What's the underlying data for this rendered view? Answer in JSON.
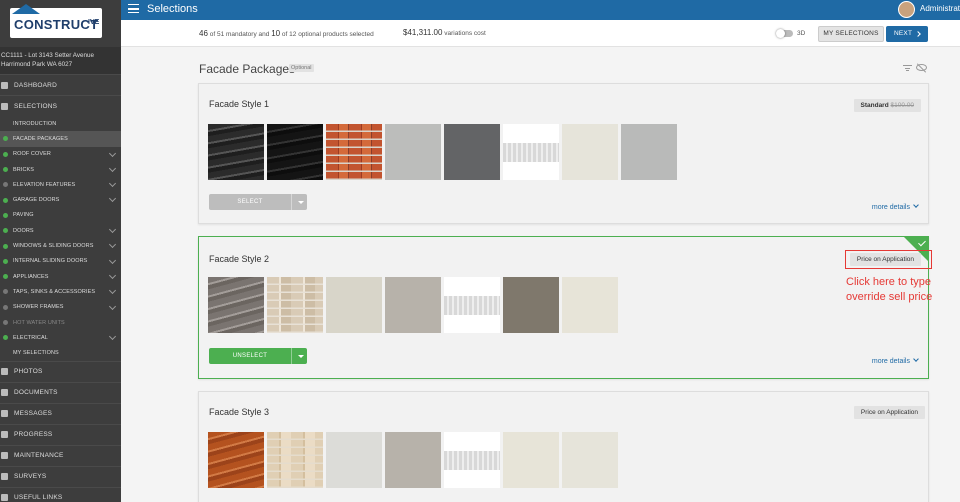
{
  "app": {
    "logo_text": "CONSTRUCT",
    "logo_suffix": "IVE",
    "page_title": "Selections",
    "user_name": "Administrator"
  },
  "sidebar": {
    "address_line1": "CC1111 - Lot 3143 Setter Avenue",
    "address_line2": "Harrimond Park WA 6027",
    "items": [
      {
        "label": "DASHBOARD",
        "type": "main",
        "icon": "dashboard-icon"
      },
      {
        "label": "SELECTIONS",
        "type": "main",
        "icon": "selections-icon"
      },
      {
        "label": "INTRODUCTION",
        "type": "plain"
      },
      {
        "label": "FACADE PACKAGES",
        "type": "sub",
        "status": "green",
        "active": true
      },
      {
        "label": "ROOF COVER",
        "type": "sub",
        "status": "green",
        "expand": true
      },
      {
        "label": "BRICKS",
        "type": "sub",
        "status": "green",
        "expand": true
      },
      {
        "label": "ELEVATION FEATURES",
        "type": "sub",
        "status": "grey",
        "expand": true
      },
      {
        "label": "GARAGE DOORS",
        "type": "sub",
        "status": "green",
        "expand": true
      },
      {
        "label": "PAVING",
        "type": "sub",
        "status": "green"
      },
      {
        "label": "DOORS",
        "type": "sub",
        "status": "green",
        "expand": true
      },
      {
        "label": "WINDOWS & SLIDING DOORS",
        "type": "sub",
        "status": "green",
        "expand": true
      },
      {
        "label": "INTERNAL SLIDING DOORS",
        "type": "sub",
        "status": "green",
        "expand": true
      },
      {
        "label": "APPLIANCES",
        "type": "sub",
        "status": "green",
        "expand": true
      },
      {
        "label": "TAPS, SINKS & ACCESSORIES",
        "type": "sub",
        "status": "grey",
        "expand": true
      },
      {
        "label": "SHOWER FRAMES",
        "type": "sub",
        "status": "grey",
        "expand": true
      },
      {
        "label": "HOT WATER UNITS",
        "type": "sub",
        "status": "grey",
        "disabled": true
      },
      {
        "label": "ELECTRICAL",
        "type": "sub",
        "status": "green",
        "expand": true
      },
      {
        "label": "MY SELECTIONS",
        "type": "plain"
      },
      {
        "label": "PHOTOS",
        "type": "main",
        "icon": "camera-icon"
      },
      {
        "label": "DOCUMENTS",
        "type": "main",
        "icon": "document-icon"
      },
      {
        "label": "MESSAGES",
        "type": "main",
        "icon": "mail-icon"
      },
      {
        "label": "PROGRESS",
        "type": "main",
        "icon": "progress-icon"
      },
      {
        "label": "MAINTENANCE",
        "type": "main",
        "icon": "wrench-icon"
      },
      {
        "label": "SURVEYS",
        "type": "main",
        "icon": "survey-icon"
      },
      {
        "label": "USEFUL LINKS",
        "type": "main",
        "icon": "link-icon"
      }
    ]
  },
  "status": {
    "mandatory_selected": "46",
    "mandatory_total": "51",
    "optional_selected": "10",
    "optional_total": "12",
    "text_of": "of",
    "text_mandatory": "mandatory and",
    "text_optional": "optional products selected",
    "variations_cost": "$41,311.00",
    "variations_label": "variations cost",
    "toggle_label": "3D",
    "my_selections_label": "MY SELECTIONS",
    "next_label": "NEXT"
  },
  "section": {
    "title": "Facade Packages",
    "badge": "Optional"
  },
  "cards": [
    {
      "title": "Facade Style 1",
      "price_label": "Standard",
      "price_strike": "$100.00",
      "button_label": "SELECT",
      "more_label": "more details",
      "selected": false,
      "swatches": [
        "tile-black",
        "tile-black2",
        "brick-red",
        "grey-light",
        "grey-dark",
        "white-panel",
        "cream",
        "silver"
      ]
    },
    {
      "title": "Facade Style 2",
      "price_label": "Price on Application",
      "button_label": "UNSELECT",
      "more_label": "more details",
      "selected": true,
      "swatches": [
        "tile-grey",
        "brick-cream",
        "cream2",
        "taupe",
        "white-panel",
        "brown-grey",
        "cream3"
      ]
    },
    {
      "title": "Facade Style 3",
      "price_label": "Price on Application",
      "selected": false,
      "swatches": [
        "tile-terracotta",
        "brick-sand",
        "pale-grey",
        "taupe",
        "white-panel",
        "cream3",
        "cream"
      ]
    }
  ],
  "annotation": {
    "line1": "Click here to type",
    "line2": "override sell price",
    "color": "#e53935"
  },
  "colors": {
    "brand_blue": "#1f6aa5",
    "success_green": "#4caf50",
    "sidebar_bg": "#3d3d3d"
  }
}
